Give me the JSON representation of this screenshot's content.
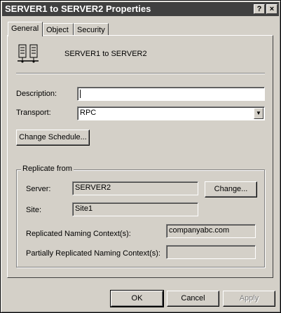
{
  "window": {
    "title": "SERVER1 to SERVER2 Properties",
    "help_btn": "?",
    "close_btn": "×"
  },
  "tabs": [
    {
      "label": "General",
      "active": true
    },
    {
      "label": "Object",
      "active": false
    },
    {
      "label": "Security",
      "active": false
    }
  ],
  "header": {
    "icon": "replication-servers-icon",
    "name": "SERVER1 to SERVER2"
  },
  "general": {
    "description_label": "Description:",
    "description_value": "",
    "transport_label": "Transport:",
    "transport_value": "RPC",
    "change_schedule_label": "Change Schedule..."
  },
  "replicate": {
    "group_title": "Replicate from",
    "server_label": "Server:",
    "server_value": "SERVER2",
    "change_label": "Change...",
    "site_label": "Site:",
    "site_value": "Site1",
    "rnc_label": "Replicated Naming Context(s):",
    "rnc_value": "companyabc.com",
    "prnc_label": "Partially Replicated Naming Context(s):",
    "prnc_value": ""
  },
  "footer": {
    "ok_label": "OK",
    "cancel_label": "Cancel",
    "apply_label": "Apply"
  },
  "colors": {
    "face": "#d4d0c8",
    "titlebar": "#404040"
  }
}
